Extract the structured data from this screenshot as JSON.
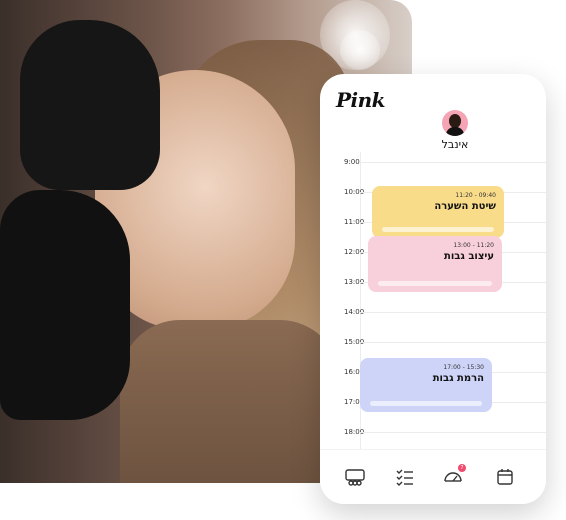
{
  "app": {
    "logo": "Pink"
  },
  "user": {
    "name": "אינבל"
  },
  "calendar": {
    "hours": [
      "9:00",
      "10:00",
      "11:00",
      "12:00",
      "13:00",
      "14:00",
      "15:00",
      "16:00",
      "17:00",
      "18:00"
    ],
    "events": [
      {
        "time": "09:40 - 11:20",
        "title": "שיטת השערה",
        "color": "#f8dc8a"
      },
      {
        "time": "11:20 - 13:00",
        "title": "עיצוב גבות",
        "color": "#f8d0dc"
      },
      {
        "time": "15:30 - 17:00",
        "title": "הרמת גבות",
        "color": "#cdd4f7"
      }
    ]
  },
  "nav": {
    "items": [
      {
        "icon": "clients-icon"
      },
      {
        "icon": "tasks-icon"
      },
      {
        "icon": "dashboard-icon",
        "badge": "7"
      },
      {
        "icon": "calendar-icon"
      }
    ]
  }
}
